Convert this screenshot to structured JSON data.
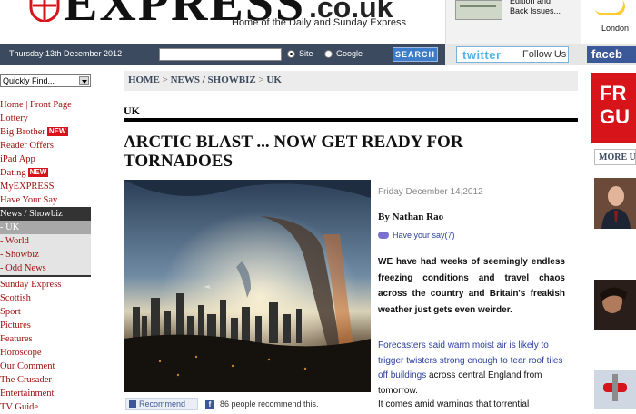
{
  "header": {
    "logo_text": "EXPRESS",
    "logo_domain": ".co.uk",
    "tagline": "Home of the Daily and Sunday Express",
    "promo_text": "Edition and\nBack Issues...",
    "weather_city": "London"
  },
  "nav": {
    "date": "Thursday 13th December 2012",
    "search_placeholder": "",
    "radio_site": "Site",
    "radio_google": "Google",
    "search_button": "SEARCH",
    "twitter_logo": "twitter",
    "twitter_follow": "Follow Us",
    "facebook_logo": "faceb"
  },
  "sidebar": {
    "quick_find": "Quickly Find...",
    "new_badge": "NEW",
    "items": [
      {
        "label": "Home | Front Page"
      },
      {
        "label": "Lottery"
      },
      {
        "label": "Big Brother"
      },
      {
        "label": "Reader Offers"
      },
      {
        "label": "iPad App"
      },
      {
        "label": "Dating"
      },
      {
        "label": "MyEXPRESS"
      },
      {
        "label": "Have Your Say"
      },
      {
        "label": "News / Showbiz"
      },
      {
        "label": "- UK"
      },
      {
        "label": "- World"
      },
      {
        "label": "- Showbiz"
      },
      {
        "label": "- Odd News"
      },
      {
        "label": "Sunday Express"
      },
      {
        "label": "Scottish"
      },
      {
        "label": "Sport"
      },
      {
        "label": "Pictures"
      },
      {
        "label": "Features"
      },
      {
        "label": "Horoscope"
      },
      {
        "label": "Our Comment"
      },
      {
        "label": "The Crusader"
      },
      {
        "label": "Entertainment"
      },
      {
        "label": "TV Guide"
      }
    ]
  },
  "article": {
    "breadcrumb": [
      "HOME",
      "NEWS / SHOWBIZ",
      "UK"
    ],
    "section": "UK",
    "headline": "ARCTIC BLAST ... NOW GET READY FOR TORNADOES",
    "date": "Friday December 14,2012",
    "byline": "By Nathan Rao",
    "have_your_say": "Have your say(7)",
    "lead": "WE have had weeks of seemingly endless freezing conditions and travel chaos across the country and Britain's freakish weather just gets even weirder.",
    "body1_link": "Forecasters said warm moist air is likely to trigger twisters strong enough to tear roof tiles off buildings",
    "body1_rest": " across central England from tomorrow.",
    "body2": "It comes amid warnings that torrential",
    "recommend_button": "Recommend",
    "recommend_count": "86 people recommend this."
  },
  "right_rail": {
    "ad_text": "FR\nGU",
    "more_tab": "MORE U"
  }
}
